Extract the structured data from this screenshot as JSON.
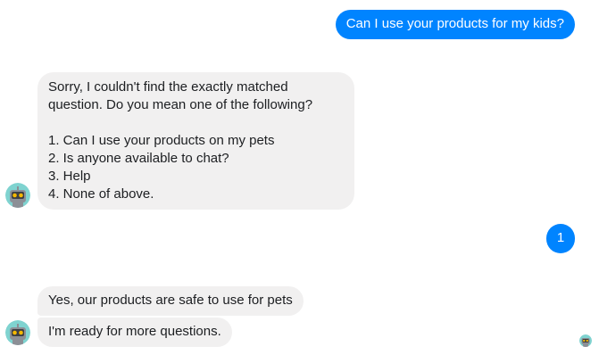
{
  "conversation": {
    "user_message_1": "Can I use your products for my kids?",
    "bot_message_1": {
      "lines": [
        "Sorry, I couldn't find the exactly matched",
        "question. Do you mean one of the following?",
        "",
        "1. Can I use your products on my pets",
        "2. Is anyone available to chat?",
        "3. Help",
        "4. None of above."
      ]
    },
    "user_message_2": "1",
    "bot_message_2": "Yes, our products are safe to use for pets",
    "bot_message_3": "I'm ready for more questions."
  },
  "icons": {
    "bot_avatar": "robot-avatar-icon",
    "read_receipt": "robot-avatar-icon"
  },
  "colors": {
    "outgoing_bubble": "#0084ff",
    "incoming_bubble": "#f1f0f0",
    "avatar_bg": "#7fd3d0",
    "avatar_eyes": "#f5b800"
  }
}
